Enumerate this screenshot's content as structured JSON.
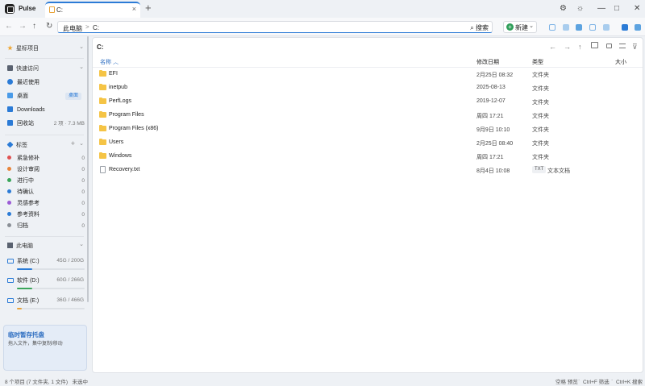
{
  "app": {
    "name": "Pulse"
  },
  "tabs": [
    {
      "label": "C:"
    }
  ],
  "icons": {
    "tab_close": "×",
    "tab_add": "+",
    "back": "←",
    "forward": "→",
    "up": "↑",
    "refresh": "↻",
    "settings": "⚙",
    "theme": "☼",
    "minimize": "—",
    "maximize": "□",
    "close": "✕",
    "search": "⌕",
    "chevron_down": "⌄",
    "chevron_right": "›",
    "sort_up": "︿",
    "plus": "+",
    "filter": "⊽"
  },
  "nav": {
    "breadcrumbs": [
      "此电脑",
      "C:"
    ],
    "crumb_sep": ">",
    "search_label": "搜索",
    "new_label": "新建"
  },
  "sidebar": {
    "favorites_label": "星标项目",
    "quick_access_label": "快速访问",
    "quick_access": [
      {
        "label": "最近使用",
        "right": ""
      },
      {
        "label": "桌面",
        "right": "桌面"
      },
      {
        "label": "Downloads",
        "right": ""
      },
      {
        "label": "回收站",
        "right": "2 项 · 7.3 MB"
      }
    ],
    "tags_label": "标签",
    "tags": [
      {
        "label": "紧急修补",
        "count": "0",
        "color": "#e05252"
      },
      {
        "label": "设计审阅",
        "count": "0",
        "color": "#e8843a"
      },
      {
        "label": "进行中",
        "count": "0",
        "color": "#3aa55a"
      },
      {
        "label": "待确认",
        "count": "0",
        "color": "#2b7bd6"
      },
      {
        "label": "灵感参考",
        "count": "0",
        "color": "#9b5bd6"
      },
      {
        "label": "参考资料",
        "count": "0",
        "color": "#2b7bd6"
      },
      {
        "label": "归档",
        "count": "0",
        "color": "#8a8f96"
      }
    ],
    "this_pc_label": "此电脑",
    "drives": [
      {
        "label": "系统 (C:)",
        "size": "45G / 200G",
        "fill": 0.225,
        "color": "#2b7bd6"
      },
      {
        "label": "软件 (D:)",
        "size": "60G / 266G",
        "fill": 0.226,
        "color": "#3aa55a"
      },
      {
        "label": "文档 (E:)",
        "size": "36G / 466G",
        "fill": 0.077,
        "color": "#e8a33a"
      }
    ],
    "tray_title": "临时暂存托盘",
    "tray_hint": "拖入文件，集中复制/移动"
  },
  "main": {
    "path": "C:",
    "columns": {
      "name": "名称",
      "date": "修改日期",
      "type": "类型",
      "size": "大小"
    },
    "files": [
      {
        "name": "EFI",
        "date": "2月25日 08:32",
        "type": "文件夹",
        "kind": "folder"
      },
      {
        "name": "inetpub",
        "date": "2025-08-13",
        "type": "文件夹",
        "kind": "folder"
      },
      {
        "name": "PerfLogs",
        "date": "2019-12-07",
        "type": "文件夹",
        "kind": "folder"
      },
      {
        "name": "Program Files",
        "date": "周四 17:21",
        "type": "文件夹",
        "kind": "folder"
      },
      {
        "name": "Program Files (x86)",
        "date": "9月9日 10:10",
        "type": "文件夹",
        "kind": "folder"
      },
      {
        "name": "Users",
        "date": "2月25日 08:40",
        "type": "文件夹",
        "kind": "folder"
      },
      {
        "name": "Windows",
        "date": "周四 17:21",
        "type": "文件夹",
        "kind": "folder"
      },
      {
        "name": "Recovery.txt",
        "date": "8月4日 10:08",
        "type": "文本文档",
        "ext": "TXT",
        "kind": "file"
      }
    ]
  },
  "status": {
    "items_text": "8 个项目 (7 文件夹, 1 文件)",
    "selection_text": "未选中",
    "hint_preview": "空格 预览",
    "hint_filter": "Ctrl+F 筛选",
    "hint_search": "Ctrl+K 搜索",
    "dot_sep": "·"
  }
}
